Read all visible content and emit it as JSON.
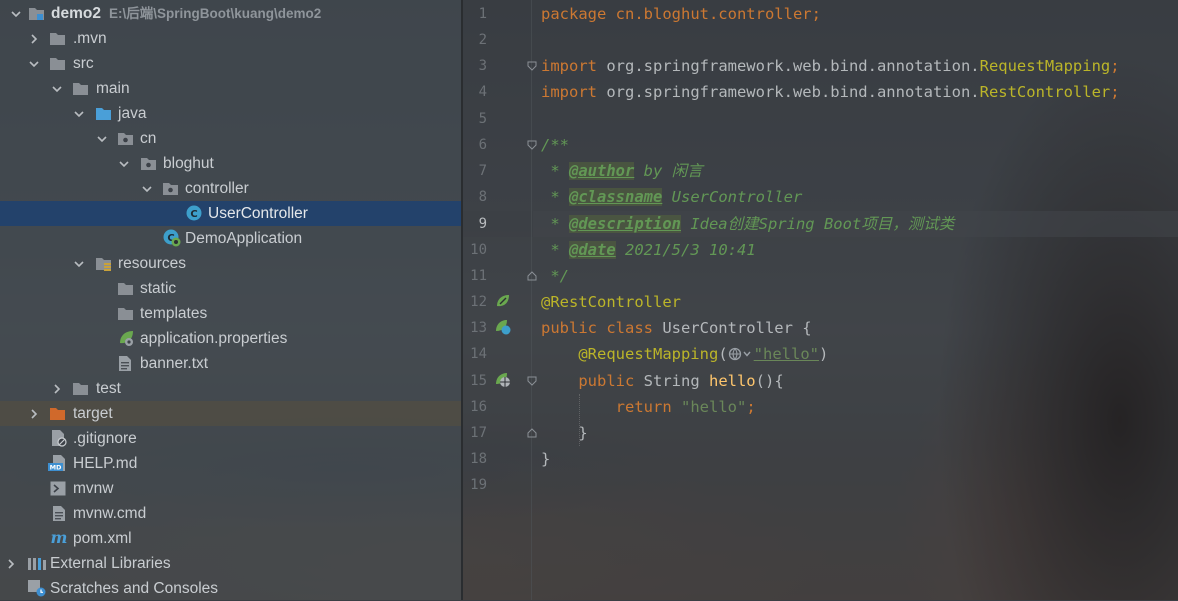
{
  "tree": {
    "root": {
      "name": "demo2",
      "path": "E:\\后端\\SpringBoot\\kuang\\demo2"
    },
    "items": [
      {
        "label": ".mvn"
      },
      {
        "label": "src"
      },
      {
        "label": "main"
      },
      {
        "label": "java"
      },
      {
        "label": "cn"
      },
      {
        "label": "bloghut"
      },
      {
        "label": "controller"
      },
      {
        "label": "UserController"
      },
      {
        "label": "DemoApplication"
      },
      {
        "label": "resources"
      },
      {
        "label": "static"
      },
      {
        "label": "templates"
      },
      {
        "label": "application.properties"
      },
      {
        "label": "banner.txt"
      },
      {
        "label": "test"
      },
      {
        "label": "target"
      },
      {
        "label": ".gitignore"
      },
      {
        "label": "HELP.md"
      },
      {
        "label": "mvnw"
      },
      {
        "label": "mvnw.cmd"
      },
      {
        "label": "pom.xml"
      },
      {
        "label": "External Libraries"
      },
      {
        "label": "Scratches and Consoles"
      }
    ],
    "md_badge": "MD"
  },
  "editor": {
    "line_numbers": [
      "1",
      "2",
      "3",
      "4",
      "5",
      "6",
      "7",
      "8",
      "9",
      "10",
      "11",
      "12",
      "13",
      "14",
      "15",
      "16",
      "17",
      "18",
      "19"
    ],
    "code": {
      "l1_kw": "package",
      "l1_rest": " cn.bloghut.controller;",
      "l3_kw": "import",
      "l3_pkg": " org.springframework.web.bind.annotation.",
      "l3_cls": "RequestMapping",
      "l4_kw": "import",
      "l4_pkg": " org.springframework.web.bind.annotation.",
      "l4_cls": "RestController",
      "semi": ";",
      "l6": "/**",
      "star": " * ",
      "l7_tag": "@author",
      "l7_val": " by 闲言",
      "l8_tag": "@classname",
      "l8_val": " UserController",
      "l9_tag": "@description",
      "l9_val": " Idea创建Spring Boot项目，测试类",
      "l10_tag": "@date",
      "l10_val": " 2021/5/3 10:41",
      "l11": " */",
      "l12": "@RestController",
      "l13_kw": "public class",
      "l13_rest": " UserController {",
      "l14_ann": "@RequestMapping",
      "l14_open": "(",
      "l14_str": "\"hello\"",
      "l14_close": ")",
      "l15_kw": "public",
      "l15_type": " String ",
      "l15_fn": "hello",
      "l15_rest": "(){",
      "l16_kw": "return",
      "l16_str": " \"hello\"",
      "l16_semi": ";",
      "l17": "}",
      "l18": "}"
    }
  },
  "colors": {
    "keyword": "#cc7832",
    "annotation": "#bbb529",
    "string": "#6a8759",
    "doc_comment": "#629755",
    "method": "#ffc66d",
    "selection": "#21426e"
  },
  "icons": {
    "folder": "folder-icon",
    "source_folder": "source-folder-icon",
    "package": "package-icon",
    "class": "class-icon",
    "spring_boot_app": "spring-boot-app-icon",
    "resources_folder": "resources-folder-icon",
    "properties": "spring-properties-icon",
    "file": "text-file-icon",
    "maven": "maven-icon",
    "libraries": "libraries-icon",
    "scratches": "scratches-icon",
    "spring_bean": "spring-bean-gutter-icon",
    "web_mapping": "web-mapping-gutter-icon"
  }
}
